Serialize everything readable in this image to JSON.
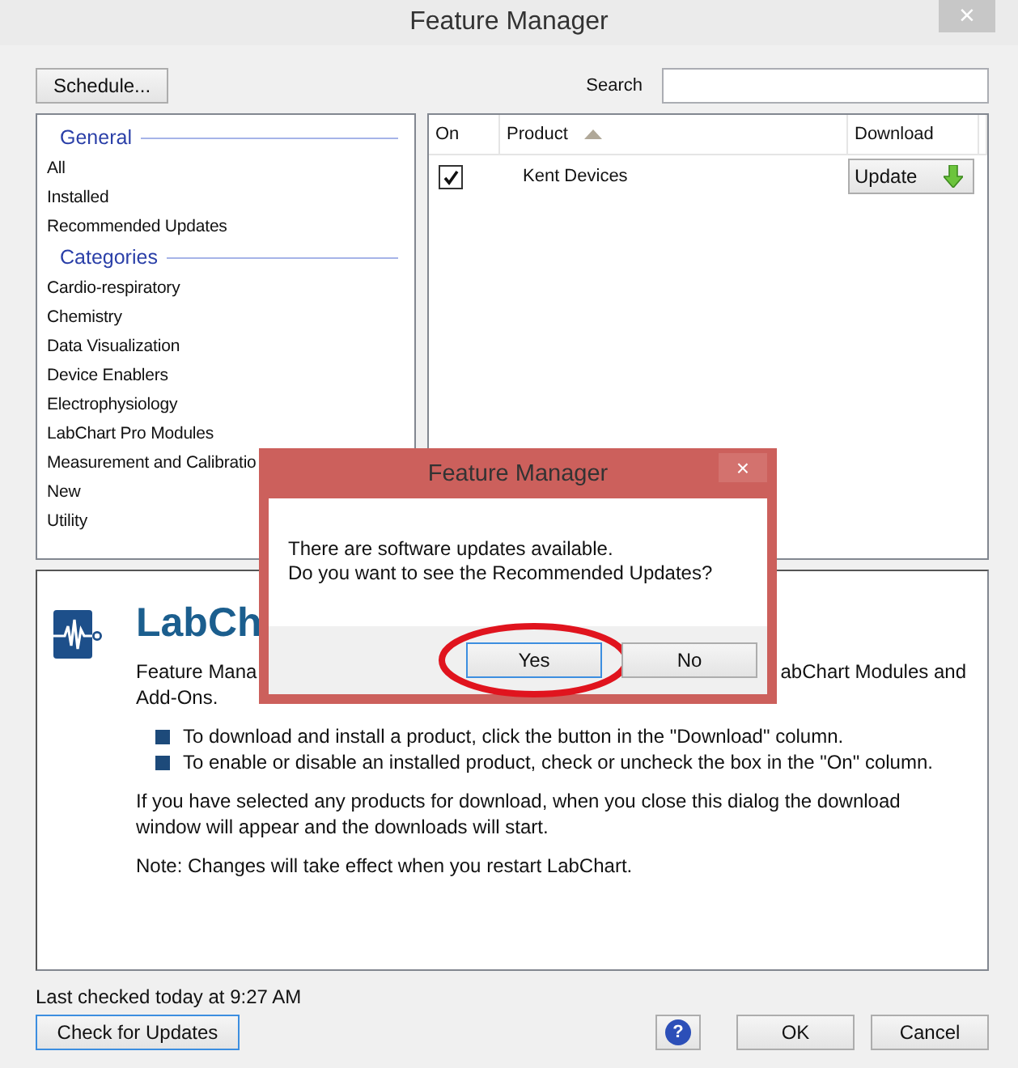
{
  "window": {
    "title": "Feature Manager",
    "close_glyph": "×"
  },
  "toolbar": {
    "schedule_button": "Schedule...",
    "search_label": "Search"
  },
  "sidebar": {
    "groups": [
      {
        "title": "General",
        "items": [
          {
            "label": "All"
          },
          {
            "label": "Installed"
          },
          {
            "label": "Recommended Updates"
          }
        ]
      },
      {
        "title": "Categories",
        "items": [
          {
            "label": "Cardio-respiratory"
          },
          {
            "label": "Chemistry"
          },
          {
            "label": "Data Visualization"
          },
          {
            "label": "Device Enablers"
          },
          {
            "label": "Electrophysiology"
          },
          {
            "label": "LabChart Pro Modules"
          },
          {
            "label": "Measurement and Calibratio"
          },
          {
            "label": "New"
          },
          {
            "label": "Utility"
          }
        ]
      }
    ]
  },
  "table": {
    "columns": [
      {
        "label": "On",
        "sorted": false
      },
      {
        "label": "Product",
        "sorted": true
      },
      {
        "label": "Download",
        "sorted": false
      }
    ],
    "rows": [
      {
        "checked": true,
        "product": "Kent Devices",
        "action": "Update"
      }
    ]
  },
  "info": {
    "heading": "LabCh",
    "intro_left": "Feature Mana",
    "intro_right": "abChart Modules and",
    "intro_line2": "Add-Ons.",
    "bullets": [
      "To download and install a product, click the button in the \"Download\" column.",
      "To enable or disable an installed product, check or uncheck the box in the \"On\" column."
    ],
    "paragraphs": [
      "If you have selected any products for download, when you close this dialog the download window will appear and the downloads will start.",
      "Note: Changes will take effect when you restart LabChart."
    ]
  },
  "status": "Last checked today at 9:27 AM",
  "footer": {
    "check_button": "Check for Updates",
    "help_glyph": "?",
    "ok_button": "OK",
    "cancel_button": "Cancel"
  },
  "dialog": {
    "title": "Feature Manager",
    "close_glyph": "×",
    "message_lines": [
      "There are software updates available.",
      "Do you want to see the Recommended Updates?"
    ],
    "buttons": [
      {
        "label": "Yes",
        "focused": true,
        "circled": true
      },
      {
        "label": "No",
        "focused": false,
        "circled": false
      }
    ]
  }
}
